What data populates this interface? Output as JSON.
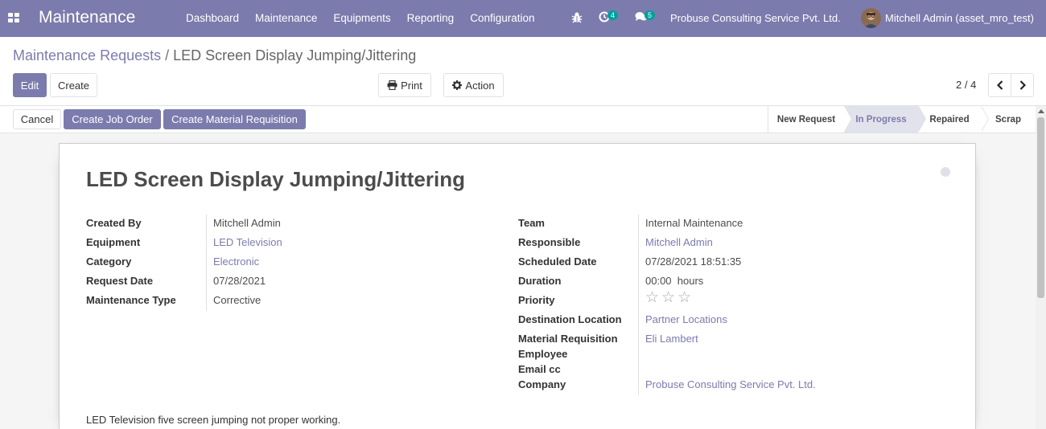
{
  "navbar": {
    "app_title": "Maintenance",
    "menu": [
      "Dashboard",
      "Maintenance",
      "Equipments",
      "Reporting",
      "Configuration"
    ],
    "activity_badge": "4",
    "message_badge": "5",
    "company": "Probuse Consulting Service Pvt. Ltd.",
    "user": "Mitchell Admin (asset_mro_test)"
  },
  "breadcrumb": {
    "parent": "Maintenance Requests",
    "separator": "/",
    "current": "LED Screen Display Jumping/Jittering"
  },
  "toolbar": {
    "edit": "Edit",
    "create": "Create",
    "print": "Print",
    "action": "Action",
    "pager": "2 / 4"
  },
  "statusbar": {
    "cancel": "Cancel",
    "create_job_order": "Create Job Order",
    "create_material_requisition": "Create Material Requisition",
    "stages": [
      "New Request",
      "In Progress",
      "Repaired",
      "Scrap"
    ],
    "active_stage": "In Progress"
  },
  "record": {
    "title": "LED Screen Display Jumping/Jittering",
    "left_fields": [
      {
        "label": "Created By",
        "value": "Mitchell Admin",
        "link": false
      },
      {
        "label": "Equipment",
        "value": "LED Television",
        "link": true
      },
      {
        "label": "Category",
        "value": "Electronic",
        "link": true
      },
      {
        "label": "Request Date",
        "value": "07/28/2021",
        "link": false
      },
      {
        "label": "Maintenance Type",
        "value": "Corrective",
        "link": false
      }
    ],
    "right_fields": {
      "team": {
        "label": "Team",
        "value": "Internal Maintenance"
      },
      "responsible": {
        "label": "Responsible",
        "value": "Mitchell Admin"
      },
      "scheduled_date": {
        "label": "Scheduled Date",
        "value": "07/28/2021 18:51:35"
      },
      "duration": {
        "label": "Duration",
        "value": "00:00",
        "unit": "hours"
      },
      "priority": {
        "label": "Priority",
        "stars_total": 3,
        "stars_filled": 0
      },
      "destination_location": {
        "label": "Destination Location",
        "value": "Partner Locations"
      },
      "material_requisition_employee": {
        "label1": "Material Requisition",
        "label2": "Employee",
        "value": "Eli Lambert"
      },
      "email_cc": {
        "label": "Email cc",
        "value": ""
      },
      "company": {
        "label": "Company",
        "value": "Probuse Consulting Service Pvt. Ltd."
      }
    },
    "description": "LED Television five screen jumping not proper working."
  },
  "colors": {
    "brand": "#7c7bad",
    "badge": "#00a09d",
    "active_stage_bg": "#e2e2ec"
  }
}
